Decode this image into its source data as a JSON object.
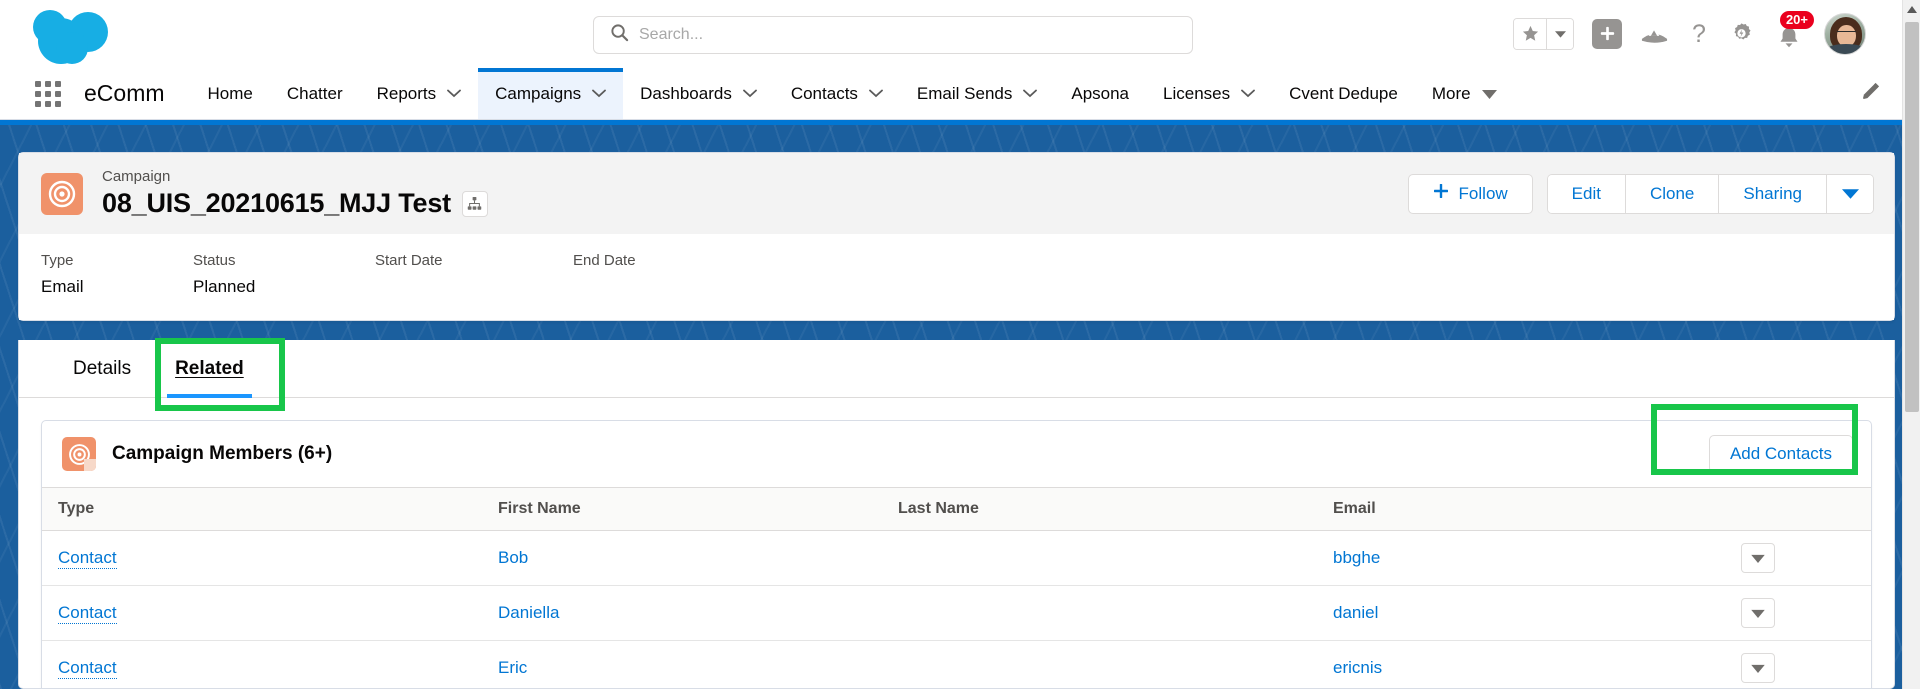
{
  "header": {
    "logo_alt": "salesforce-cloud-logo",
    "search": {
      "placeholder": "Search...",
      "value": "",
      "icon": "search-icon"
    },
    "icons": {
      "favorites": "star-icon",
      "favorites_caret": "chevron-down-icon",
      "add": "plus-icon",
      "ascent": "mountain-icon",
      "help": "question-mark-icon",
      "setup": "gear-icon",
      "notifications": "bell-icon",
      "avatar": "user-avatar"
    },
    "notification_badge": "20+"
  },
  "nav": {
    "app_launcher": "app-launcher-icon",
    "app_name": "eComm",
    "items": [
      {
        "label": "Home",
        "has_caret": false,
        "active": false
      },
      {
        "label": "Chatter",
        "has_caret": false,
        "active": false
      },
      {
        "label": "Reports",
        "has_caret": true,
        "active": false
      },
      {
        "label": "Campaigns",
        "has_caret": true,
        "active": true
      },
      {
        "label": "Dashboards",
        "has_caret": true,
        "active": false
      },
      {
        "label": "Contacts",
        "has_caret": true,
        "active": false
      },
      {
        "label": "Email Sends",
        "has_caret": true,
        "active": false
      },
      {
        "label": "Apsona",
        "has_caret": false,
        "active": false
      },
      {
        "label": "Licenses",
        "has_caret": true,
        "active": false
      },
      {
        "label": "Cvent Dedupe",
        "has_caret": false,
        "active": false
      },
      {
        "label": "More",
        "has_caret": true,
        "active": false
      }
    ],
    "edit_icon": "pencil-icon"
  },
  "record": {
    "object_icon": "campaign-target-icon",
    "type_label": "Campaign",
    "name": "08_UIS_20210615_MJJ Test",
    "hierarchy_icon": "hierarchy-icon",
    "actions": {
      "follow": "Follow",
      "follow_icon": "plus-icon",
      "edit": "Edit",
      "clone": "Clone",
      "sharing": "Sharing",
      "more_caret": "chevron-down-icon"
    },
    "fields": [
      {
        "label": "Type",
        "value": "Email"
      },
      {
        "label": "Status",
        "value": "Planned"
      },
      {
        "label": "Start Date",
        "value": ""
      },
      {
        "label": "End Date",
        "value": ""
      }
    ]
  },
  "tabs": [
    {
      "label": "Details",
      "active": false
    },
    {
      "label": "Related",
      "active": true
    }
  ],
  "related_list": {
    "icon": "campaign-member-icon",
    "title": "Campaign Members (6+)",
    "add_button": "Add Contacts",
    "columns": [
      "Type",
      "First Name",
      "Last Name",
      "Email"
    ],
    "rows": [
      {
        "type": "Contact",
        "first_name": "Bob",
        "last_name": "",
        "email": "bbghe"
      },
      {
        "type": "Contact",
        "first_name": "Daniella",
        "last_name": "",
        "email": "daniel"
      },
      {
        "type": "Contact",
        "first_name": "Eric",
        "last_name": "",
        "email": "ericnis"
      }
    ],
    "row_action_icon": "chevron-down-icon"
  },
  "annotations": {
    "color": "#18c64a",
    "targets": [
      "Related",
      "Add Contacts"
    ]
  },
  "scrollbar": {
    "up_icon": "triangle-up-icon",
    "down_icon": "triangle-down-icon"
  }
}
